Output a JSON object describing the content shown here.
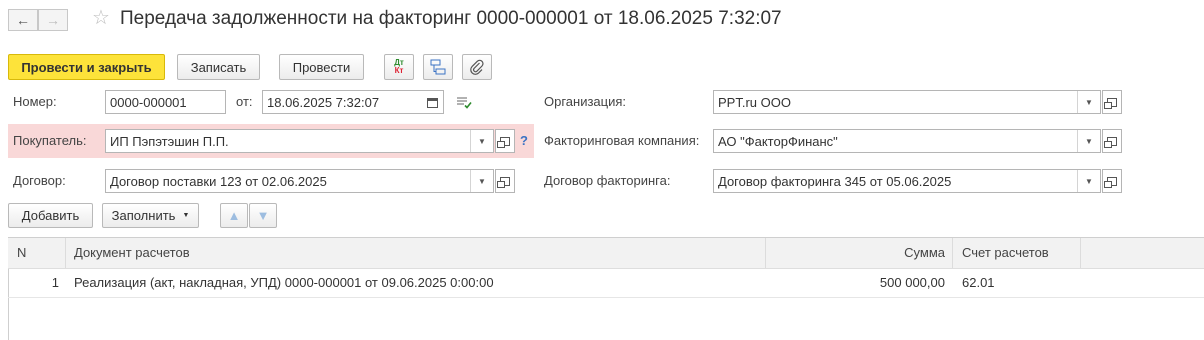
{
  "header": {
    "title": "Передача задолженности на факторинг 0000-000001 от 18.06.2025 7:32:07",
    "back_icon": "←",
    "forward_icon": "→",
    "star_icon": "☆"
  },
  "toolbar": {
    "post_close": "Провести и закрыть",
    "save": "Записать",
    "post": "Провести",
    "dtkt_top": "Дт",
    "dtkt_bottom": "Кт"
  },
  "form": {
    "number_label": "Номер:",
    "number_value": "0000-000001",
    "date_label": "от:",
    "date_value": "18.06.2025  7:32:07",
    "buyer_label": "Покупатель:",
    "buyer_value": "ИП Пэпэтэшин П.П.",
    "help_mark": "?",
    "contract_label": "Договор:",
    "contract_value": "Договор поставки 123 от 02.06.2025",
    "org_label": "Организация:",
    "org_value": "PPT.ru ООО",
    "factor_label": "Факторинговая компания:",
    "factor_value": "АО \"ФакторФинанс\"",
    "factor_contract_label": "Договор факторинга:",
    "factor_contract_value": "Договор факторинга 345 от 05.06.2025"
  },
  "table_toolbar": {
    "add": "Добавить",
    "fill": "Заполнить"
  },
  "table": {
    "columns": [
      "N",
      "Документ расчетов",
      "Сумма",
      "Счет расчетов"
    ],
    "rows": [
      {
        "n": "1",
        "doc": "Реализация (акт, накладная, УПД) 0000-000001 от 09.06.2025 0:00:00",
        "sum": "500 000,00",
        "account": "62.01"
      }
    ]
  },
  "colors": {
    "primary_button": "#fde33a",
    "error_highlight": "#f9d8d8",
    "link_blue": "#3b73c4"
  }
}
